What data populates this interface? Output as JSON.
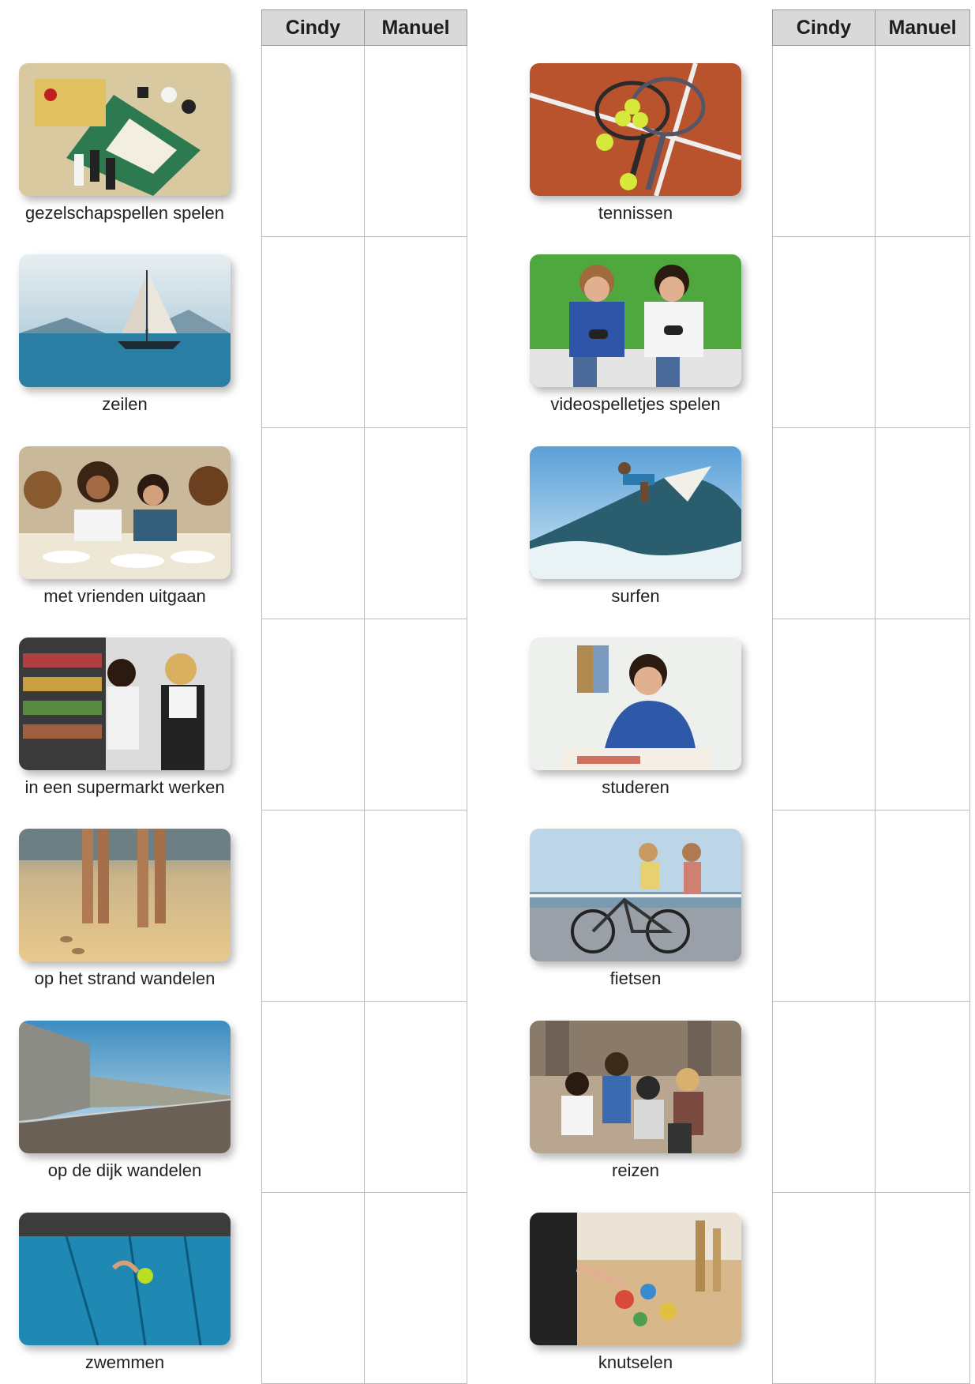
{
  "table": {
    "col_cindy": "Cindy",
    "col_manuel": "Manuel"
  },
  "left_activities": [
    {
      "label": "gezelschapspellen spelen"
    },
    {
      "label": "zeilen"
    },
    {
      "label": "met vrienden uitgaan"
    },
    {
      "label": "in een supermarkt werken"
    },
    {
      "label": "op het strand wandelen"
    },
    {
      "label": "op de dijk wandelen"
    },
    {
      "label": "zwemmen"
    }
  ],
  "right_activities": [
    {
      "label": "tennissen"
    },
    {
      "label": "videospelletjes spelen"
    },
    {
      "label": "surfen"
    },
    {
      "label": "studeren"
    },
    {
      "label": "fietsen"
    },
    {
      "label": "reizen"
    },
    {
      "label": "knutselen"
    }
  ]
}
